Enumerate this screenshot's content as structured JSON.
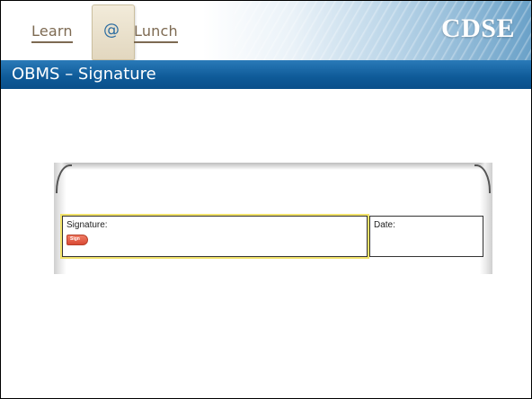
{
  "header": {
    "logo": {
      "word_left": "Learn",
      "at": "@",
      "word_right": "Lunch"
    },
    "brand": "CDSE"
  },
  "title": "OBMS – Signature",
  "form": {
    "signature_label": "Signature:",
    "sign_tab": "Sign",
    "date_label": "Date:"
  },
  "colors": {
    "title_bar": "#0e5a98",
    "highlight": "#f2e36b",
    "sign_tab": "#d94a34",
    "logo_text": "#7d6a52"
  }
}
